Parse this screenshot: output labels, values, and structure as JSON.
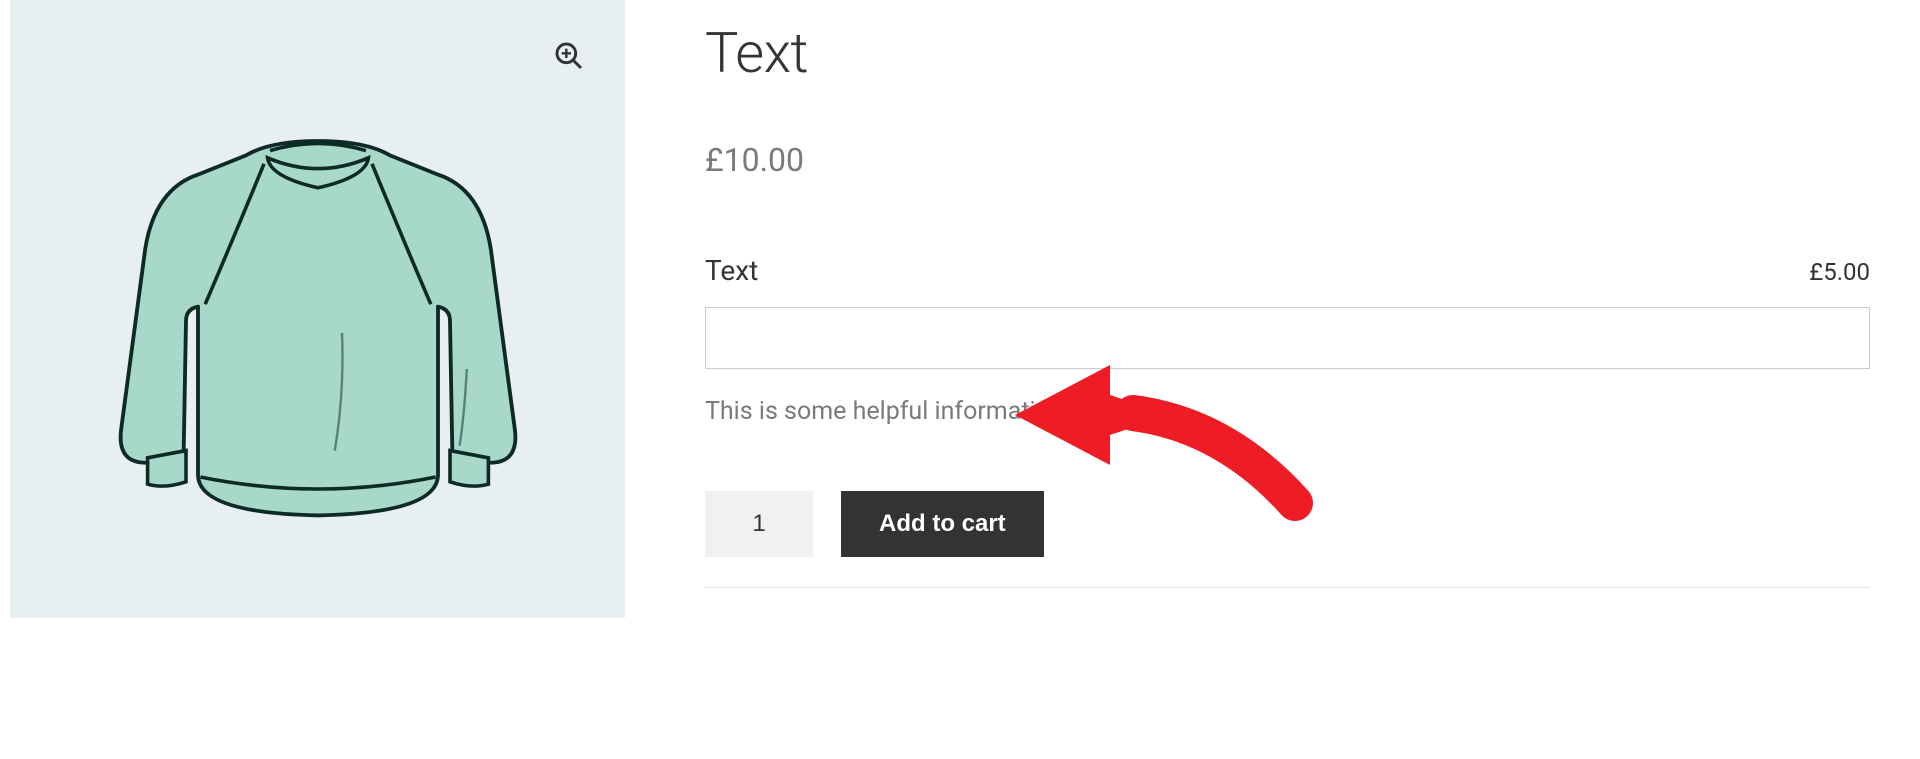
{
  "product": {
    "title": "Text",
    "price": "£10.00"
  },
  "addon": {
    "label": "Text",
    "price": "£5.00",
    "value": "",
    "description": "This is some helpful information"
  },
  "cart": {
    "quantity": "1",
    "add_label": "Add to cart"
  },
  "icons": {
    "zoom": "zoom-in"
  }
}
